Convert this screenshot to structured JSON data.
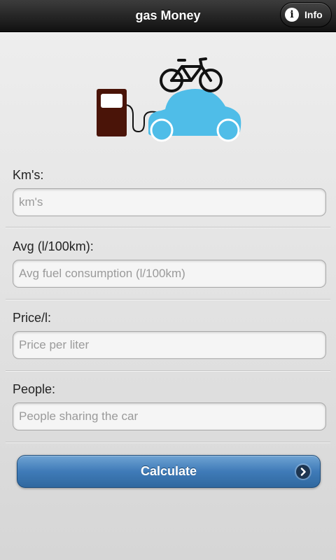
{
  "header": {
    "title": "gas Money",
    "info_label": "Info"
  },
  "illustration": {
    "icons": [
      "gas-pump-icon",
      "bicycle-icon",
      "car-icon"
    ],
    "colors": {
      "pump": "#4a1408",
      "car": "#4fbde8",
      "bicycle": "#111111"
    }
  },
  "form": {
    "fields": [
      {
        "label": "Km's:",
        "placeholder": "km's",
        "value": ""
      },
      {
        "label": "Avg (l/100km):",
        "placeholder": "Avg fuel consumption (l/100km)",
        "value": ""
      },
      {
        "label": "Price/l:",
        "placeholder": "Price per liter",
        "value": ""
      },
      {
        "label": "People:",
        "placeholder": "People sharing the car",
        "value": ""
      }
    ]
  },
  "calculate": {
    "label": "Calculate",
    "icon": "chevron-right-icon",
    "color": "#3f7bb8"
  }
}
